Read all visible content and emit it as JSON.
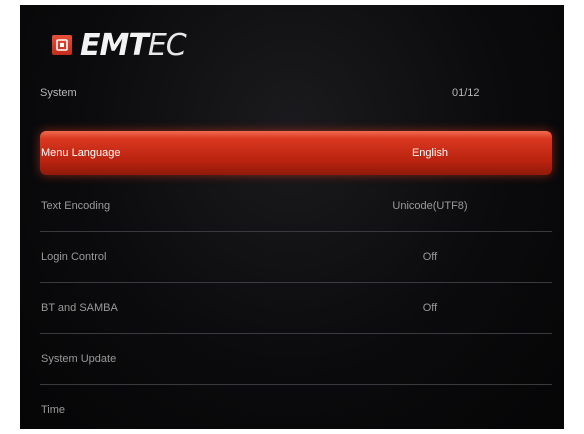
{
  "brand": {
    "name_bold": "EM",
    "name_mid": "T",
    "name_thin": "EC",
    "accent_color": "#d9371f"
  },
  "header": {
    "title": "System",
    "page_indicator": "01/12"
  },
  "menu": {
    "selected_index": 0,
    "items": [
      {
        "label": "Menu Language",
        "value": "English"
      },
      {
        "label": "Text Encoding",
        "value": "Unicode(UTF8)"
      },
      {
        "label": "Login Control",
        "value": "Off"
      },
      {
        "label": "BT and SAMBA",
        "value": "Off"
      },
      {
        "label": "System Update",
        "value": ""
      },
      {
        "label": "Time",
        "value": ""
      }
    ]
  },
  "icons": {
    "logo": "emtec-logo-icon"
  }
}
